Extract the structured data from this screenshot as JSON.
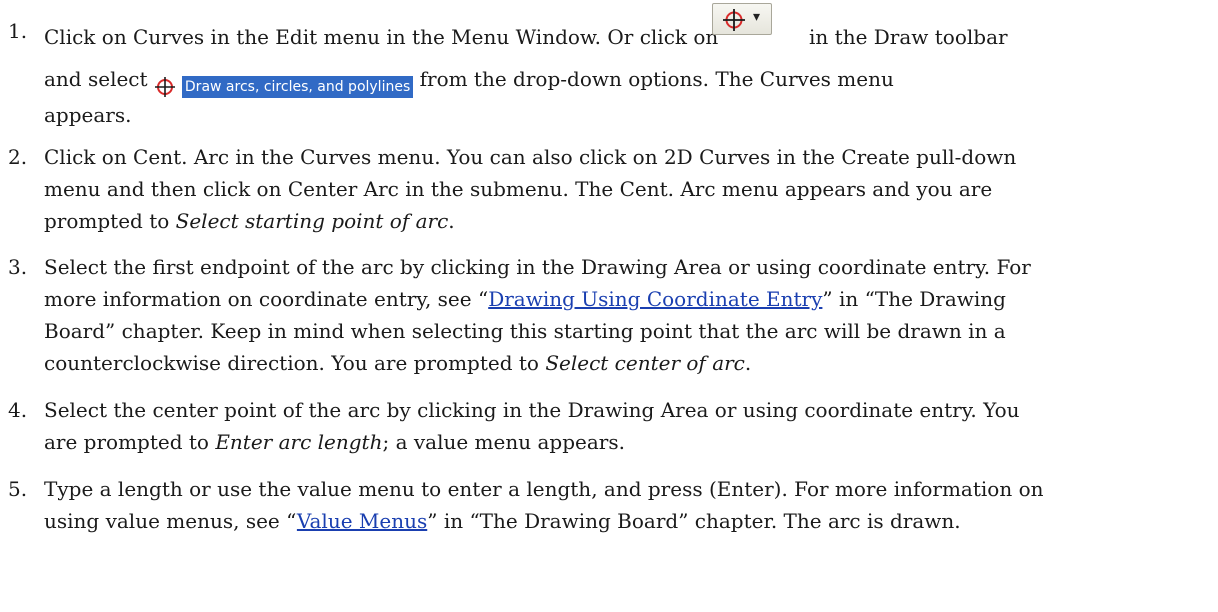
{
  "steps": [
    {
      "number": "1.",
      "line1_a": "Click on Curves in the Edit menu in the Menu Window. Or click on",
      "line1_b": "in the Draw toolbar",
      "line2_a": "and select",
      "menu_option_label": "Draw arcs, circles, and polylines",
      "line2_b": "from the drop-down options. The Curves menu",
      "line3": "appears."
    },
    {
      "number": "2.",
      "line1": "Click on Cent. Arc in the Curves menu. You can also click on 2D Curves in the Create pull-down",
      "line2": "menu and then click on Center Arc in the submenu. The Cent. Arc menu appears and you are",
      "line3_a": "prompted to ",
      "line3_em": "Select starting point of arc",
      "line3_b": "."
    },
    {
      "number": "3.",
      "line1": "Select the first endpoint of the arc by clicking in the Drawing Area or using coordinate entry. For",
      "line2_a": "more information on coordinate entry, see “",
      "line2_link": "Drawing Using Coordinate Entry",
      "line2_b": "” in “The Drawing",
      "line3": "Board” chapter. Keep in mind when selecting this starting point that the arc will be drawn in a",
      "line4_a": "counterclockwise direction. You are prompted to ",
      "line4_em": "Select center of arc",
      "line4_b": "."
    },
    {
      "number": "4.",
      "line1": "Select the center point of the arc by clicking in the Drawing Area or using coordinate entry. You",
      "line2_a": "are prompted to ",
      "line2_em": "Enter arc length",
      "line2_b": "; a value menu appears."
    },
    {
      "number": "5.",
      "line1": "Type a length or use the value menu to enter a length, and press (Enter). For more information on",
      "line2_a": "using value menus, see “",
      "line2_link": "Value Menus",
      "line2_b": "” in “The Drawing Board” chapter. The arc is drawn."
    }
  ],
  "toolbar_button": {
    "icon": "crosshair-circle-icon",
    "caret_icon": "chevron-down-icon",
    "caret_glyph": "▾"
  },
  "colors": {
    "link": "#1a3fb0",
    "menu_highlight": "#316ac5",
    "icon_red": "#d92b2b"
  }
}
